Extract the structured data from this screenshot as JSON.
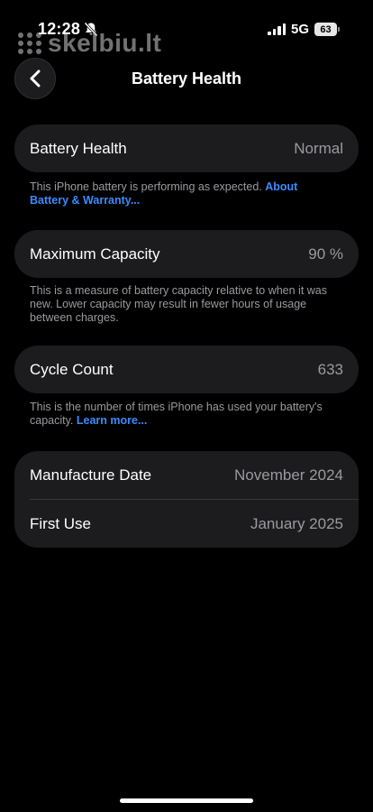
{
  "status_bar": {
    "time": "12:28",
    "network": "5G",
    "battery_level": "63",
    "signal_bars": 4
  },
  "watermark": {
    "text": "skelbiu.lt"
  },
  "nav": {
    "title": "Battery Health",
    "back_icon": "chevron-left-icon"
  },
  "battery_health": {
    "label": "Battery Health",
    "value": "Normal",
    "description": "This iPhone battery is performing as expected. ",
    "link": "About Battery & Warranty..."
  },
  "max_capacity": {
    "label": "Maximum Capacity",
    "value": "90 %",
    "description": "This is a measure of battery capacity relative to when it was new. Lower capacity may result in fewer hours of usage between charges."
  },
  "cycle_count": {
    "label": "Cycle Count",
    "value": "633",
    "description": "This is the number of times iPhone has used your battery's capacity. ",
    "link": "Learn more..."
  },
  "dates": {
    "manufacture_label": "Manufacture Date",
    "manufacture_value": "November 2024",
    "first_use_label": "First Use",
    "first_use_value": "January 2025"
  },
  "colors": {
    "background": "#000000",
    "card": "#1c1c1e",
    "link": "#3b8bff",
    "secondary_text": "#9a9a9f"
  }
}
